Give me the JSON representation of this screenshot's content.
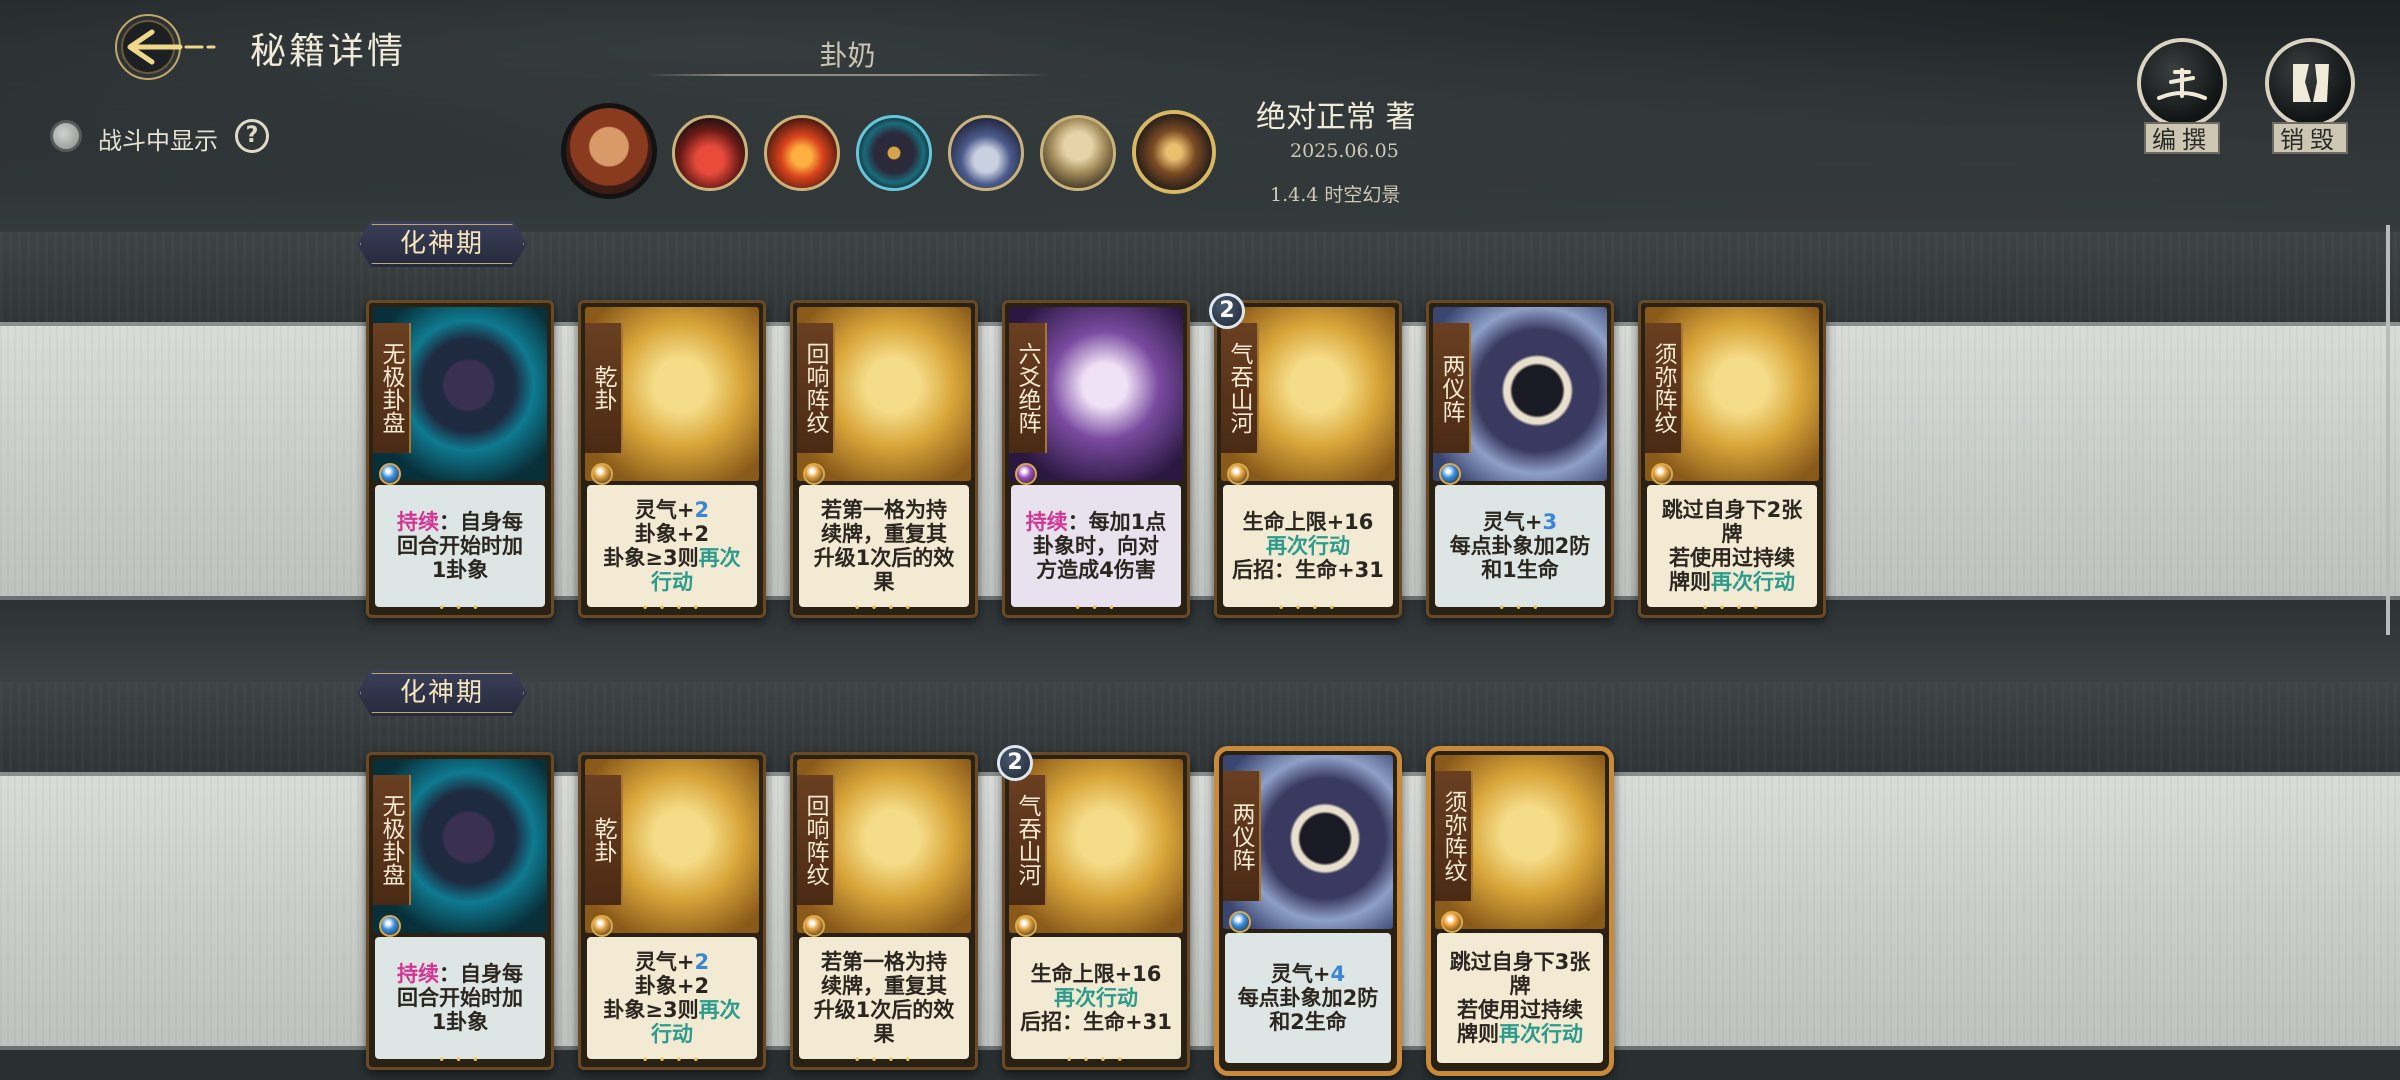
{
  "header": {
    "title": "秘籍详情",
    "deck_name": "卦奶",
    "show_in_battle_label": "战斗中显示",
    "help_label": "?",
    "author": "绝对正常 著",
    "date": "2025.06.05",
    "version": "1.4.4 时空幻景",
    "buttons": {
      "edit": "编撰",
      "destroy": "销毁"
    }
  },
  "portraits": [
    {
      "icon": "character-portrait-icon"
    },
    {
      "icon": "red-lightning-icon"
    },
    {
      "icon": "fire-icon"
    },
    {
      "icon": "bagua-compass-icon"
    },
    {
      "icon": "cloud-pavilion-icon"
    },
    {
      "icon": "elder-figure-icon"
    },
    {
      "icon": "fan-talisman-icon"
    }
  ],
  "decks": [
    {
      "realm": "化神期",
      "cards": [
        {
          "name": "无极卦盘",
          "art": "cyan",
          "gem": "blue",
          "desc": [
            [
              "持续",
              "：自身每"
            ],
            [
              "",
              "回合开始时加"
            ],
            [
              "",
              "1卦象"
            ]
          ],
          "desc_bg": "#dde6e4",
          "dots": "• • •"
        },
        {
          "name": "乾卦",
          "art": "gold",
          "gem": "gold",
          "desc": [
            [
              "",
              "灵气+"
            ],
            [
              "",
              "卦象+2"
            ],
            [
              "",
              "卦象≥3则"
            ]
          ],
          "desc_extra": {
            "l1_num": "2",
            "l3_kw": "再次",
            "l4_kw": "行动"
          },
          "desc_bg": "#f2ead2",
          "dots": "• • • •"
        },
        {
          "name": "回响阵纹",
          "art": "gold",
          "gem": "gold",
          "desc_plain": [
            "若第一格为持",
            "续牌，重复其",
            "升级1次后的效",
            "果"
          ],
          "desc_bg": "#f2ead2",
          "dots": "• • • •"
        },
        {
          "name": "六爻绝阵",
          "art": "purple",
          "gem": "purple",
          "desc_kw": {
            "kw": "持续",
            "rest": [
              "：每加1点",
              "卦象时，向对",
              "方造成4伤害"
            ]
          },
          "desc_bg": "#e8e2ee",
          "dots": "• • •"
        },
        {
          "name": "气吞山河",
          "art": "gold",
          "gem": "gold",
          "badge": "2",
          "desc_hp": {
            "l1": "生命上限+16",
            "l2": "再次行动",
            "l3": "后招：生命+31"
          },
          "desc_bg": "#f2ead2",
          "dots": "• • • •"
        },
        {
          "name": "两仪阵",
          "art": "blue",
          "gem": "blue",
          "desc_lq": {
            "num": "3",
            "l2": "每点卦象加2防",
            "l3": "和1生命"
          },
          "desc_bg": "#dde6e4",
          "dots": "• • •"
        },
        {
          "name": "须弥阵纹",
          "art": "gold",
          "gem": "gold",
          "desc_skip": {
            "l1": "跳过自身下2张",
            "l2": "牌",
            "l3": "若使用过持续",
            "l4": "牌则",
            "kw": "再次行动"
          },
          "desc_bg": "#f2ead2",
          "dots": "• • • •"
        }
      ]
    },
    {
      "realm": "化神期",
      "cards": [
        {
          "name": "无极卦盘",
          "art": "cyan",
          "gem": "blue",
          "desc": [
            [
              "持续",
              "：自身每"
            ],
            [
              "",
              "回合开始时加"
            ],
            [
              "",
              "1卦象"
            ]
          ],
          "desc_bg": "#dde6e4",
          "dots": "• • •"
        },
        {
          "name": "乾卦",
          "art": "gold",
          "gem": "gold",
          "desc": [
            [
              "",
              "灵气+"
            ],
            [
              "",
              "卦象+2"
            ],
            [
              "",
              "卦象≥3则"
            ]
          ],
          "desc_extra": {
            "l1_num": "2",
            "l3_kw": "再次",
            "l4_kw": "行动"
          },
          "desc_bg": "#f2ead2",
          "dots": "• • • •"
        },
        {
          "name": "回响阵纹",
          "art": "gold",
          "gem": "gold",
          "desc_plain": [
            "若第一格为持",
            "续牌，重复其",
            "升级1次后的效",
            "果"
          ],
          "desc_bg": "#f2ead2",
          "dots": "• • • •"
        },
        {
          "name": "气吞山河",
          "art": "gold",
          "gem": "gold",
          "badge": "2",
          "desc_hp": {
            "l1": "生命上限+16",
            "l2": "再次行动",
            "l3": "后招：生命+31"
          },
          "desc_bg": "#f2ead2",
          "dots": "• • • •"
        },
        {
          "name": "两仪阵",
          "art": "blue",
          "gem": "blue",
          "frame": "gold",
          "desc_lq": {
            "num": "4",
            "l2": "每点卦象加2防",
            "l3": "和2生命"
          },
          "desc_bg": "#dde6e4",
          "dots": ""
        },
        {
          "name": "须弥阵纹",
          "art": "gold",
          "gem": "orange",
          "frame": "gold",
          "desc_skip": {
            "l1": "跳过自身下3张",
            "l2": "牌",
            "l3": "若使用过持续",
            "l4": "牌则",
            "kw": "再次行动"
          },
          "desc_bg": "#f2ead2",
          "dots": ""
        }
      ]
    }
  ]
}
